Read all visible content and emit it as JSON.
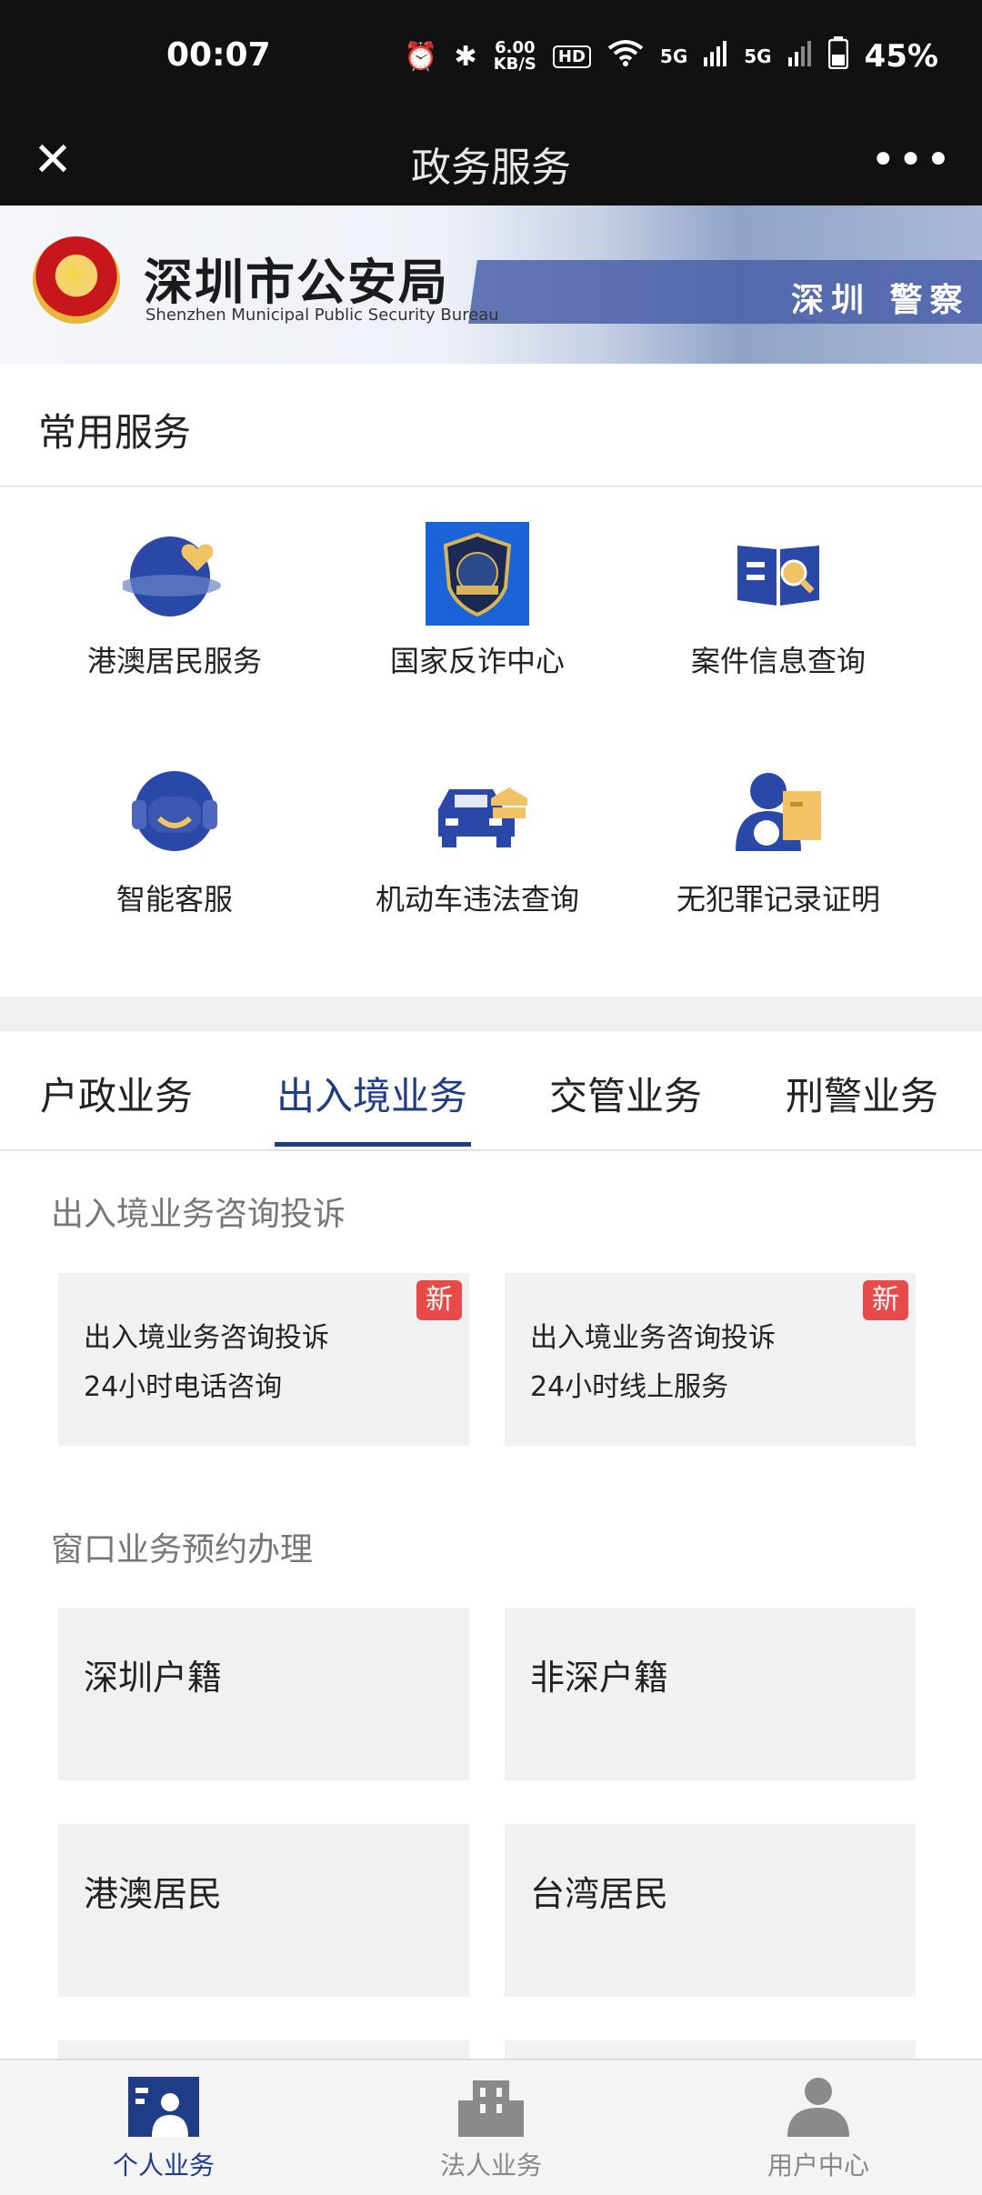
{
  "status_bar": {
    "time": "00:07",
    "net_speed_top": "6.00",
    "net_speed_bottom": "KB/S",
    "hd": "HD",
    "signal1": "5G",
    "signal2": "5G",
    "battery": "45%"
  },
  "nav": {
    "close": "✕",
    "title": "政务服务",
    "more": "•••"
  },
  "banner": {
    "title": "深圳市公安局",
    "subtitle": "Shenzhen Municipal Public Security Bureau",
    "stripe_text": "深圳 警察"
  },
  "common_services": {
    "title": "常用服务",
    "items": [
      {
        "label": "港澳居民服务",
        "icon": "planet-heart-icon"
      },
      {
        "label": "国家反诈中心",
        "icon": "anti-fraud-badge-icon"
      },
      {
        "label": "案件信息查询",
        "icon": "book-search-icon"
      },
      {
        "label": "智能客服",
        "icon": "headset-icon"
      },
      {
        "label": "机动车违法查询",
        "icon": "police-car-icon"
      },
      {
        "label": "无犯罪记录证明",
        "icon": "person-document-icon"
      }
    ]
  },
  "tabs": [
    {
      "label": "户政业务"
    },
    {
      "label": "出入境业务"
    },
    {
      "label": "交管业务"
    },
    {
      "label": "刑警业务"
    }
  ],
  "section1": {
    "title": "出入境业务咨询投诉",
    "cards": [
      {
        "line1": "出入境业务咨询投诉",
        "line2": "24小时电话咨询",
        "badge": "新"
      },
      {
        "line1": "出入境业务咨询投诉",
        "line2": "24小时线上服务",
        "badge": "新"
      }
    ]
  },
  "section2": {
    "title": "窗口业务预约办理",
    "cards": [
      {
        "label": "深圳户籍"
      },
      {
        "label": "非深户籍"
      },
      {
        "label": "港澳居民"
      },
      {
        "label": "台湾居民"
      }
    ]
  },
  "bottom_nav": [
    {
      "label": "个人业务",
      "icon": "personal-card-icon",
      "active": true
    },
    {
      "label": "法人业务",
      "icon": "building-icon",
      "active": false
    },
    {
      "label": "用户中心",
      "icon": "user-icon",
      "active": false
    }
  ],
  "colors": {
    "accent": "#1f3c86",
    "badge": "#e84a4a",
    "icon_blue": "#2a48a8",
    "icon_gold": "#f2c266"
  }
}
